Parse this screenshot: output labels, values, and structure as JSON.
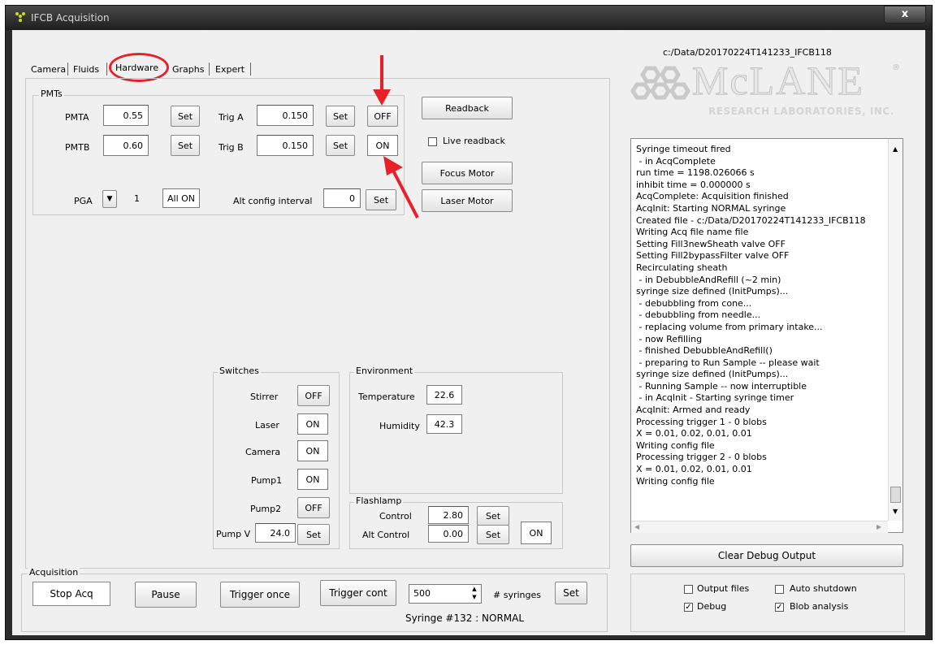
{
  "window": {
    "title": "IFCB Acquisition",
    "close_glyph": "x"
  },
  "tabs": [
    "Camera",
    "Fluids",
    "Hardware",
    "Graphs",
    "Expert"
  ],
  "path_label": "c:/Data/D20170224T141233_IFCB118",
  "logo": {
    "main": "McLANE",
    "sub": "RESEARCH LABORATORIES, INC.",
    "mark": "®"
  },
  "pmts": {
    "title": "PMTs",
    "pmta_label": "PMTA",
    "pmta_value": "0.55",
    "pmtb_label": "PMTB",
    "pmtb_value": "0.60",
    "triga_label": "Trig A",
    "triga_value": "0.150",
    "triga_state": "OFF",
    "trigb_label": "Trig B",
    "trigb_value": "0.150",
    "trigb_state": "ON",
    "set_label": "Set",
    "pga_label": "PGA",
    "pga_value": "1",
    "pga_dropdown": "▼",
    "all_on_label": "All ON",
    "alt_label": "Alt config interval",
    "alt_value": "0"
  },
  "side_buttons": {
    "readback": "Readback",
    "live_readback": "Live readback",
    "focus_motor": "Focus Motor",
    "laser_motor": "Laser Motor"
  },
  "switches": {
    "title": "Switches",
    "items": [
      {
        "label": "Stirrer",
        "state": "OFF"
      },
      {
        "label": "Laser",
        "state": "ON"
      },
      {
        "label": "Camera",
        "state": "ON"
      },
      {
        "label": "Pump1",
        "state": "ON"
      },
      {
        "label": "Pump2",
        "state": "OFF"
      }
    ],
    "pumpv_label": "Pump V",
    "pumpv_value": "24.0",
    "set_label": "Set"
  },
  "environment": {
    "title": "Environment",
    "temperature_label": "Temperature",
    "temperature_value": "22.6",
    "humidity_label": "Humidity",
    "humidity_value": "42.3"
  },
  "flashlamp": {
    "title": "Flashlamp",
    "control_label": "Control",
    "control_value": "2.80",
    "alt_control_label": "Alt Control",
    "alt_control_value": "0.00",
    "alt_state": "ON",
    "set_label": "Set"
  },
  "debug_log": [
    "Syringe timeout fired",
    " - in AcqComplete",
    "run time = 1198.026066 s",
    "inhibit time = 0.000000 s",
    "AcqComplete: Acquisition finished",
    "AcqInit: Starting NORMAL syringe",
    "Created file - c:/Data/D20170224T141233_IFCB118",
    "Writing Acq file name file",
    "Setting Fill3newSheath valve OFF",
    "Setting Fill2bypassFilter valve OFF",
    "Recirculating sheath",
    " - in DebubbleAndRefill (~2 min)",
    "syringe size defined (InitPumps)...",
    " - debubbling from cone...",
    " - debubbling from needle...",
    " - replacing volume from primary intake...",
    " - now Refilling",
    " - finished DebubbleAndRefill()",
    " - preparing to Run Sample -- please wait",
    "syringe size defined (InitPumps)...",
    " - Running Sample -- now interruptible",
    " - in AcqInit - Starting syringe timer",
    "AcqInit: Armed and ready",
    "Processing trigger 1 - 0 blobs",
    "X = 0.01, 0.02, 0.01, 0.01",
    "Writing config file",
    "Processing trigger 2 - 0 blobs",
    "X = 0.01, 0.02, 0.01, 0.01",
    "Writing config file"
  ],
  "clear_debug": "Clear Debug Output",
  "acquisition": {
    "title": "Acquisition",
    "stop": "Stop Acq",
    "pause": "Pause",
    "trigger_once": "Trigger once",
    "trigger_cont": "Trigger cont",
    "syringes_value": "500",
    "syringes_label": "# syringes",
    "set": "Set",
    "status": "Syringe #132 : NORMAL"
  },
  "options": {
    "output_files": {
      "label": "Output files",
      "checked": false
    },
    "auto_shutdown": {
      "label": "Auto shutdown",
      "checked": false
    },
    "debug": {
      "label": "Debug",
      "checked": true
    },
    "blob_analysis": {
      "label": "Blob analysis",
      "checked": true
    }
  },
  "colors": {
    "annotation_red": "#e8202a",
    "logo_blue": "#1f4e9c"
  }
}
